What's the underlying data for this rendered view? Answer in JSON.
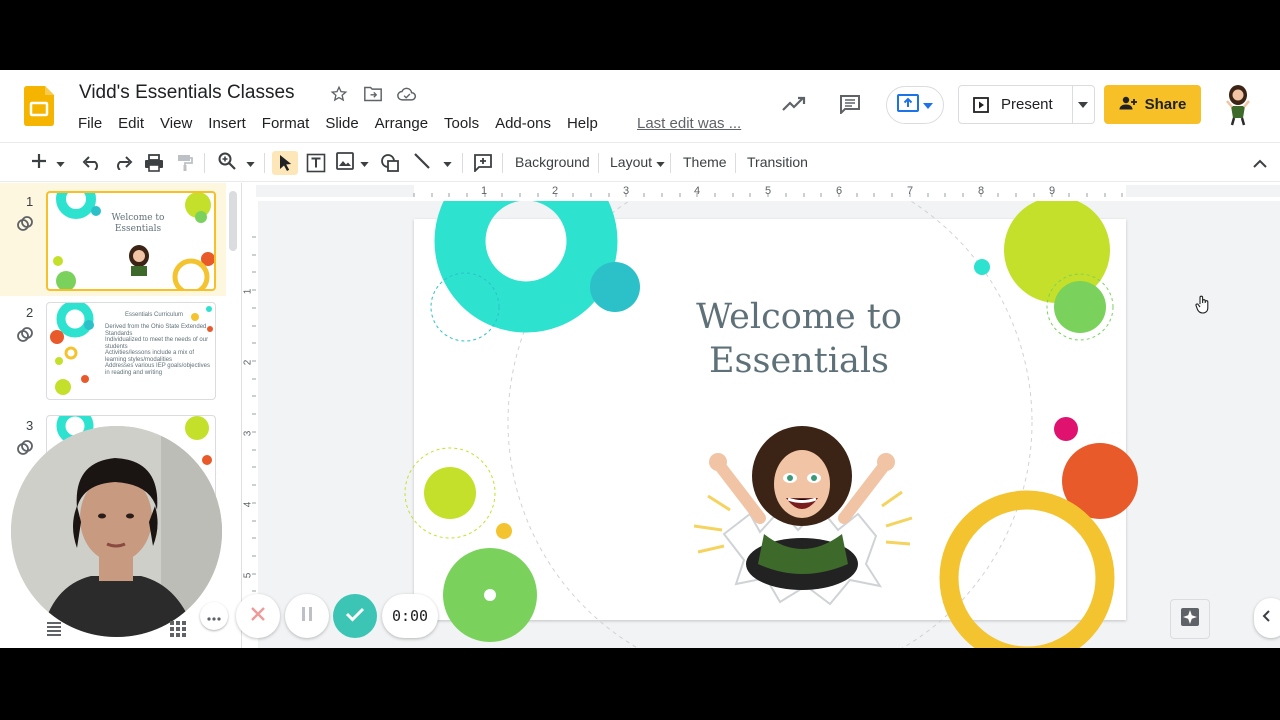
{
  "header": {
    "title": "Vidd's Essentials Classes",
    "last_edit": "Last edit was ...",
    "present_label": "Present",
    "share_label": "Share"
  },
  "menu": [
    "File",
    "Edit",
    "View",
    "Insert",
    "Format",
    "Slide",
    "Arrange",
    "Tools",
    "Add-ons",
    "Help"
  ],
  "toolbar": {
    "background_label": "Background",
    "layout_label": "Layout",
    "theme_label": "Theme",
    "transition_label": "Transition"
  },
  "ruler": {
    "horizontal": [
      "1",
      "2",
      "3",
      "4",
      "5",
      "6",
      "7",
      "8",
      "9"
    ],
    "vertical": [
      "1",
      "2",
      "3",
      "4",
      "5"
    ]
  },
  "filmstrip": {
    "slides": [
      {
        "number": "1",
        "title": "Welcome to Essentials"
      },
      {
        "number": "2",
        "title": "Essentials Curriculum",
        "bullets": [
          "Derived from the Ohio State Extended Standards",
          "Individualized to meet the needs of our students",
          "Activities/lessons include a mix of learning styles/modalities",
          "Addresses various IEP goals/objectives in reading and writing"
        ]
      },
      {
        "number": "3"
      }
    ]
  },
  "slide": {
    "title_line1": "Welcome to",
    "title_line2": "Essentials"
  },
  "recorder": {
    "timer": "0:00"
  },
  "colors": {
    "teal": "#2de2cf",
    "lime": "#c5e02a",
    "green": "#7ad25d",
    "orange": "#e85a2a",
    "yellow": "#f4c430",
    "magenta": "#e0126f",
    "share": "#f6c026",
    "title_text": "#5f7178"
  }
}
